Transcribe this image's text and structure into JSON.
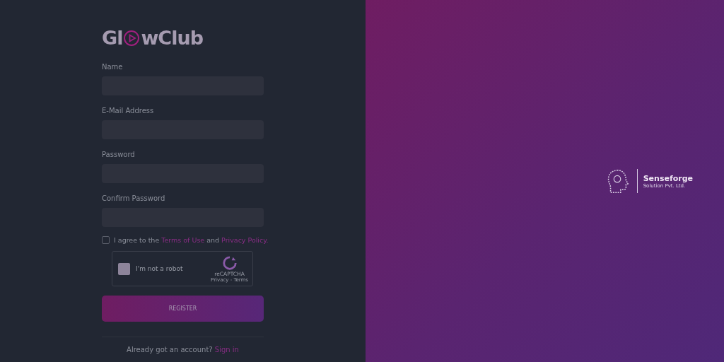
{
  "logo": {
    "text_before_icon": "Gl",
    "text_after_icon": "wClub"
  },
  "fields": [
    {
      "label": "Name"
    },
    {
      "label": "E-Mail Address"
    },
    {
      "label": "Password"
    },
    {
      "label": "Confirm Password"
    }
  ],
  "agree": {
    "checked": false,
    "text_1": "I agree to the",
    "terms_link": "Terms of Use",
    "text_2": "and",
    "privacy_link": "Privacy Policy."
  },
  "captcha": {
    "checked": false,
    "label": "I'm not a robot",
    "brand": "reCAPTCHA",
    "links": "Privacy - Terms"
  },
  "register_button": "REGISTER",
  "signin": {
    "prompt": "Already got an account?",
    "link": "Sign in"
  },
  "company": {
    "name": "Senseforge",
    "subtitle": "Solution Pvt. Ltd."
  }
}
